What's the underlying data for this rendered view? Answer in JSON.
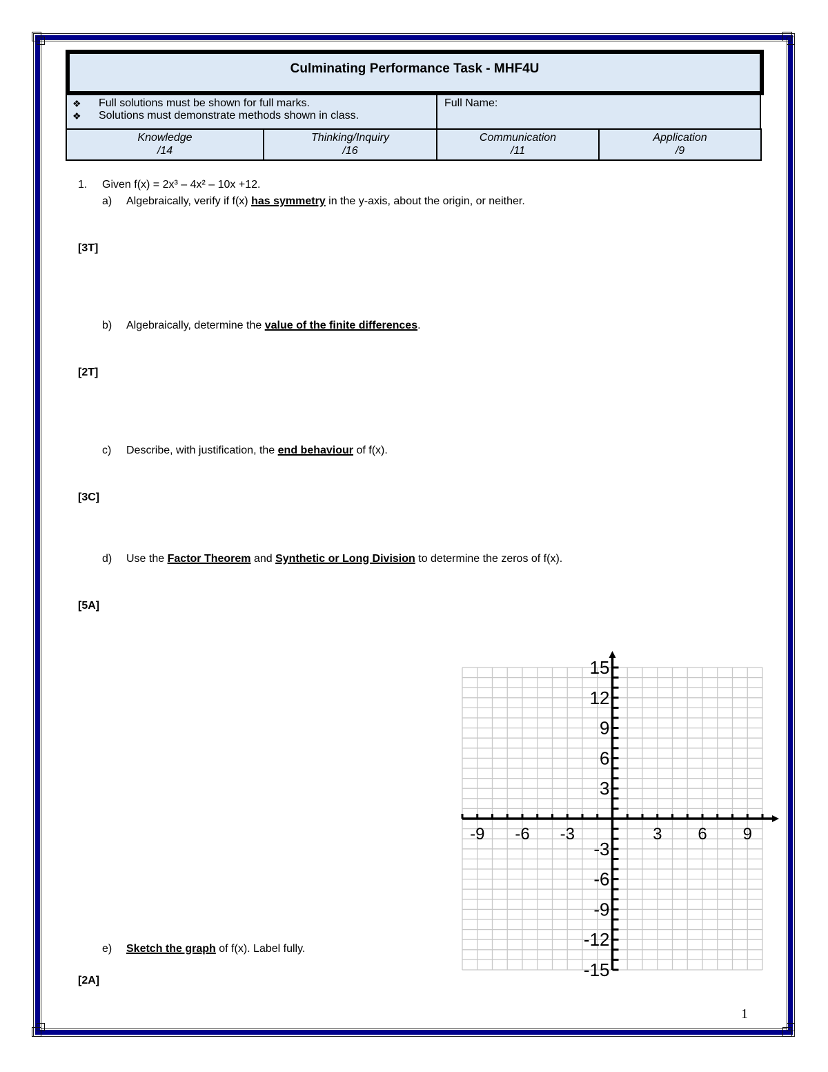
{
  "header": {
    "title": "Culminating Performance Task - MHF4U",
    "instructions": [
      "Full solutions must be shown for full marks.",
      "Solutions must demonstrate methods shown in class."
    ],
    "bullet_icon": "❖",
    "full_name_label": "Full Name:",
    "categories": [
      {
        "name": "Knowledge",
        "total": "/14"
      },
      {
        "name": "Thinking/Inquiry",
        "total": "/16"
      },
      {
        "name": "Communication",
        "total": "/11"
      },
      {
        "name": "Application",
        "total": "/9"
      }
    ]
  },
  "question1": {
    "number": "1.",
    "stem": "Given f(x) = 2x³ – 4x² – 10x +12.",
    "parts": [
      {
        "label": "a)",
        "pre": "Algebraically, verify if f(x) ",
        "emph": "has symmetry",
        "post": " in the y-axis, about the origin, or neither.",
        "marks": "[3T]"
      },
      {
        "label": "b)",
        "pre": "Algebraically, determine the ",
        "emph": "value of the finite differences",
        "post": ".",
        "marks": "[2T]"
      },
      {
        "label": "c)",
        "pre": "Describe, with justification, the ",
        "emph": "end behaviour",
        "post": " of f(x).",
        "marks": "[3C]"
      },
      {
        "label": "d)",
        "pre": "Use the ",
        "emph": "Factor Theorem",
        "mid": " and ",
        "emph2": "Synthetic or Long Division",
        "post": " to determine the zeros of f(x).",
        "marks": "[5A]"
      },
      {
        "label": "e)",
        "pre": "",
        "emph": "Sketch the graph",
        "post": " of f(x). Label fully.",
        "marks": "[2A]"
      }
    ]
  },
  "graph": {
    "x_range": [
      -10,
      10
    ],
    "y_range": [
      -15,
      15
    ],
    "x_labels": [
      "-9",
      "-6",
      "-3",
      "3",
      "6",
      "9"
    ],
    "x_label_values": [
      -9,
      -6,
      -3,
      3,
      6,
      9
    ],
    "y_labels": [
      "15",
      "12",
      "9",
      "6",
      "3",
      "-3",
      "-6",
      "-9",
      "-12",
      "-15"
    ],
    "y_label_values": [
      15,
      12,
      9,
      6,
      3,
      -3,
      -6,
      -9,
      -12,
      -15
    ],
    "grid_color": "#c8c8c8"
  },
  "page_number": "1",
  "colors": {
    "border_blue": "#00008b",
    "header_fill": "#dce8f5"
  }
}
